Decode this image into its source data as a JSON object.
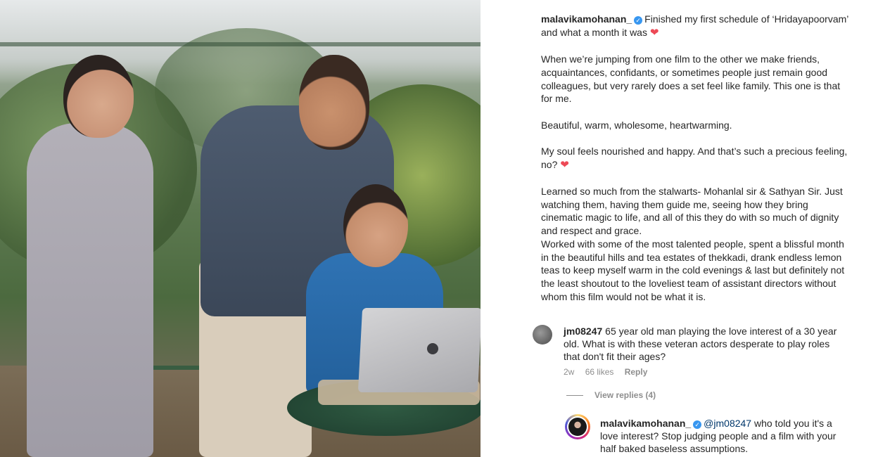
{
  "post": {
    "username": "malavikamohanan_",
    "caption_first": "Finished my first schedule of ‘Hridayapoorvam’ and what a month it was",
    "paragraphs": [
      "When we’re jumping from one film to the other we make friends, acquaintances, confidants, or sometimes people just remain good colleagues, but very rarely does a set feel like family. This one is that for me.",
      "Beautiful, warm, wholesome, heartwarming.",
      "My soul feels nourished and happy. And that’s such a precious feeling, no?",
      "Learned so much from the stalwarts- Mohanlal sir & Sathyan Sir. Just watching them, having them guide me, seeing how they bring cinematic magic to life, and all of this they do with so much of dignity and respect and grace.",
      "Worked with some of the most talented people, spent a blissful month in the beautiful hills and tea estates of thekkadi, drank endless lemon teas to keep myself warm in the cold evenings & last but definitely not the least shoutout to the loveliest team of assistant directors without whom this film would not be what it is."
    ],
    "heart_glyph": "❤"
  },
  "comment": {
    "username": "jm08247",
    "text": "65 year old man playing the love interest of a 30 year old. What is with these veteran actors desperate to play roles that don't fit their ages?",
    "time": "2w",
    "likes": "66 likes",
    "reply_label": "Reply",
    "view_replies": "View replies (4)"
  },
  "reply": {
    "username": "malavikamohanan_",
    "mention": "@jm08247",
    "text": "who told you it's a love interest? Stop judging people and a film with your half baked baseless assumptions."
  },
  "icons": {
    "verified": "verified-badge-icon",
    "heart": "heart-icon"
  },
  "colors": {
    "verified": "#3897f0",
    "heart": "#ed4956",
    "meta": "#8e8e8e",
    "mention": "#00376b"
  }
}
